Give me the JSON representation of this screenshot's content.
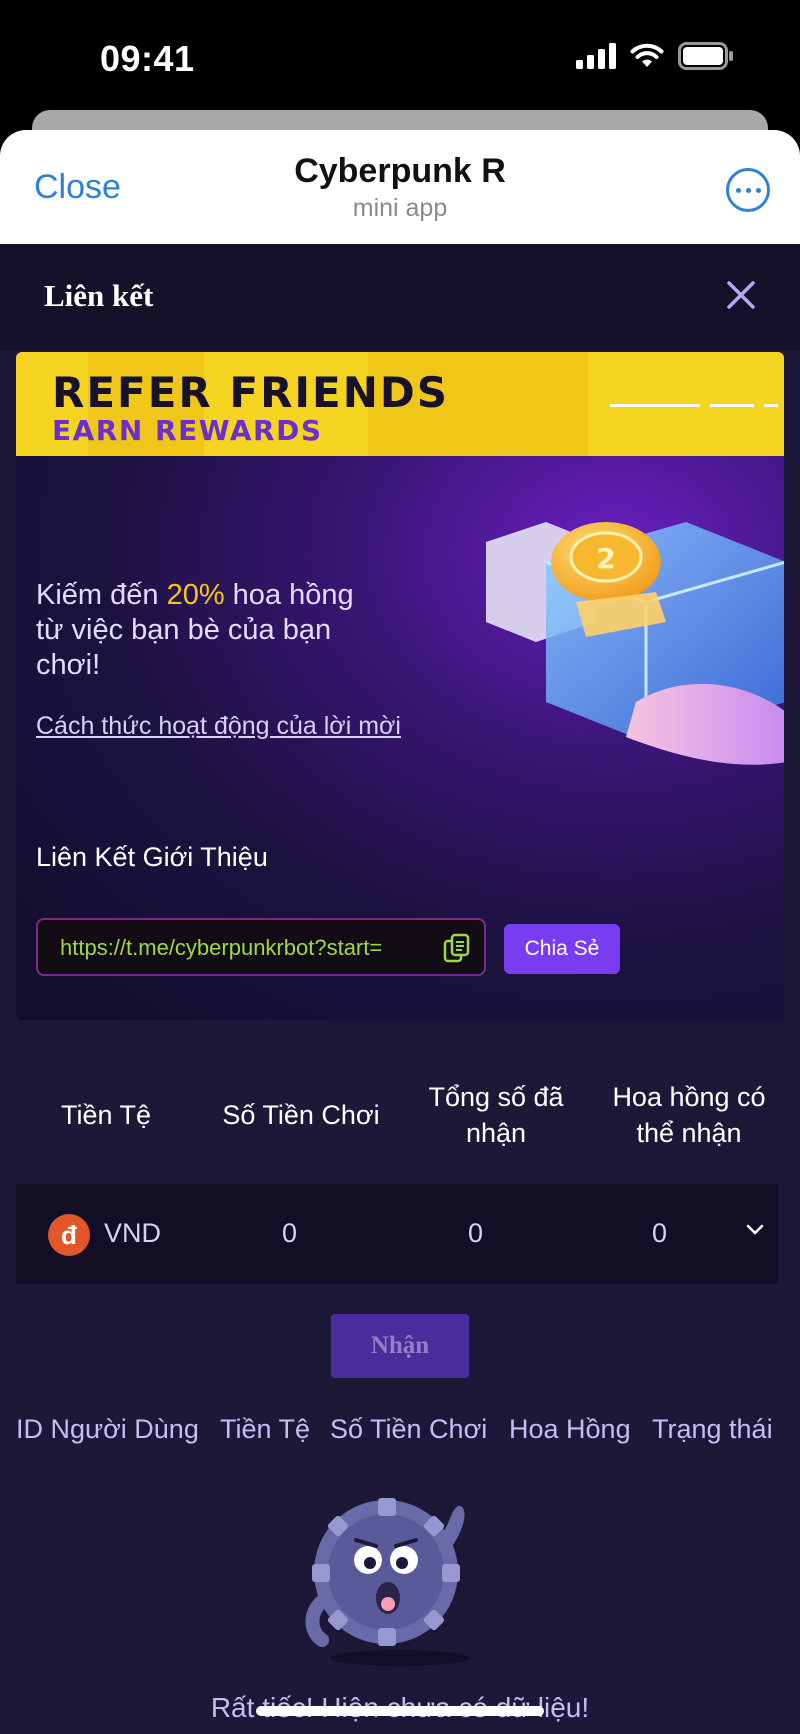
{
  "status_bar": {
    "time": "09:41"
  },
  "telegram_header": {
    "close_label": "Close",
    "title": "Cyberpunk R",
    "subtitle": "mini app"
  },
  "modal": {
    "title": "Liên kết"
  },
  "banner": {
    "line1": "REFER FRIENDS",
    "line2": "EARN REWARDS"
  },
  "promo": {
    "text_before": "Kiếm đến ",
    "highlight": "20%",
    "text_after": " hoa hồng từ việc bạn bè của bạn chơi!",
    "how_it_works_link": "Cách thức hoạt động của lời mời"
  },
  "referral": {
    "label": "Liên Kết Giới Thiệu",
    "link_value": "https://t.me/cyberpunkrbot?start=",
    "share_label": "Chia Sẻ"
  },
  "summary_table": {
    "headers": [
      "Tiền Tệ",
      "Số Tiền Chơi",
      "Tổng số đã nhận",
      "Hoa hồng có thể nhận"
    ],
    "rows": [
      {
        "currency_symbol": "đ",
        "currency": "VND",
        "played": "0",
        "received": "0",
        "claimable": "0"
      }
    ]
  },
  "claim_button": "Nhận",
  "history_table": {
    "headers": [
      "ID Người Dùng",
      "Tiền Tệ",
      "Số Tiền Chơi",
      "Hoa Hồng",
      "Trạng thái"
    ]
  },
  "empty_state": {
    "message": "Rất tiếc! Hiện chưa có dữ liệu!"
  },
  "colors": {
    "accent_blue": "#2f80d8",
    "background": "#1e1838",
    "banner_yellow": "#f5d321",
    "highlight": "#f5c518",
    "share_button": "#7a3cf0",
    "link_green": "#9bd84a"
  },
  "icons": [
    "signal-icon",
    "wifi-icon",
    "battery-icon",
    "more-icon",
    "close-icon",
    "copy-icon",
    "vnd-currency-icon",
    "chevron-down-icon"
  ]
}
